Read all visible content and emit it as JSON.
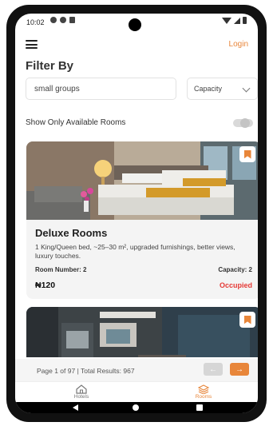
{
  "status_bar": {
    "time": "10:02"
  },
  "header": {
    "login_label": "Login"
  },
  "filter": {
    "title": "Filter By",
    "search_value": "small groups",
    "capacity_label": "Capacity",
    "available_label": "Show Only Available Rooms",
    "available_on": false
  },
  "rooms": [
    {
      "title": "Deluxe Rooms",
      "description": "1 King/Queen bed, ~25–30 m², upgraded furnishings, better views, luxury touches.",
      "room_number_label": "Room Number: 2",
      "capacity_label": "Capacity: 2",
      "price": "₦120",
      "status": "Occupied"
    }
  ],
  "pagination": {
    "info": "Page 1 of 97 | Total Results: 967",
    "prev_icon": "arrow-left-icon",
    "next_icon": "arrow-right-icon"
  },
  "tabs": [
    {
      "label": "Hotels",
      "icon": "hotel-icon",
      "active": false
    },
    {
      "label": "Rooms",
      "icon": "rooms-icon",
      "active": true
    }
  ],
  "colors": {
    "accent": "#e8863a",
    "occupied": "#e53935"
  }
}
